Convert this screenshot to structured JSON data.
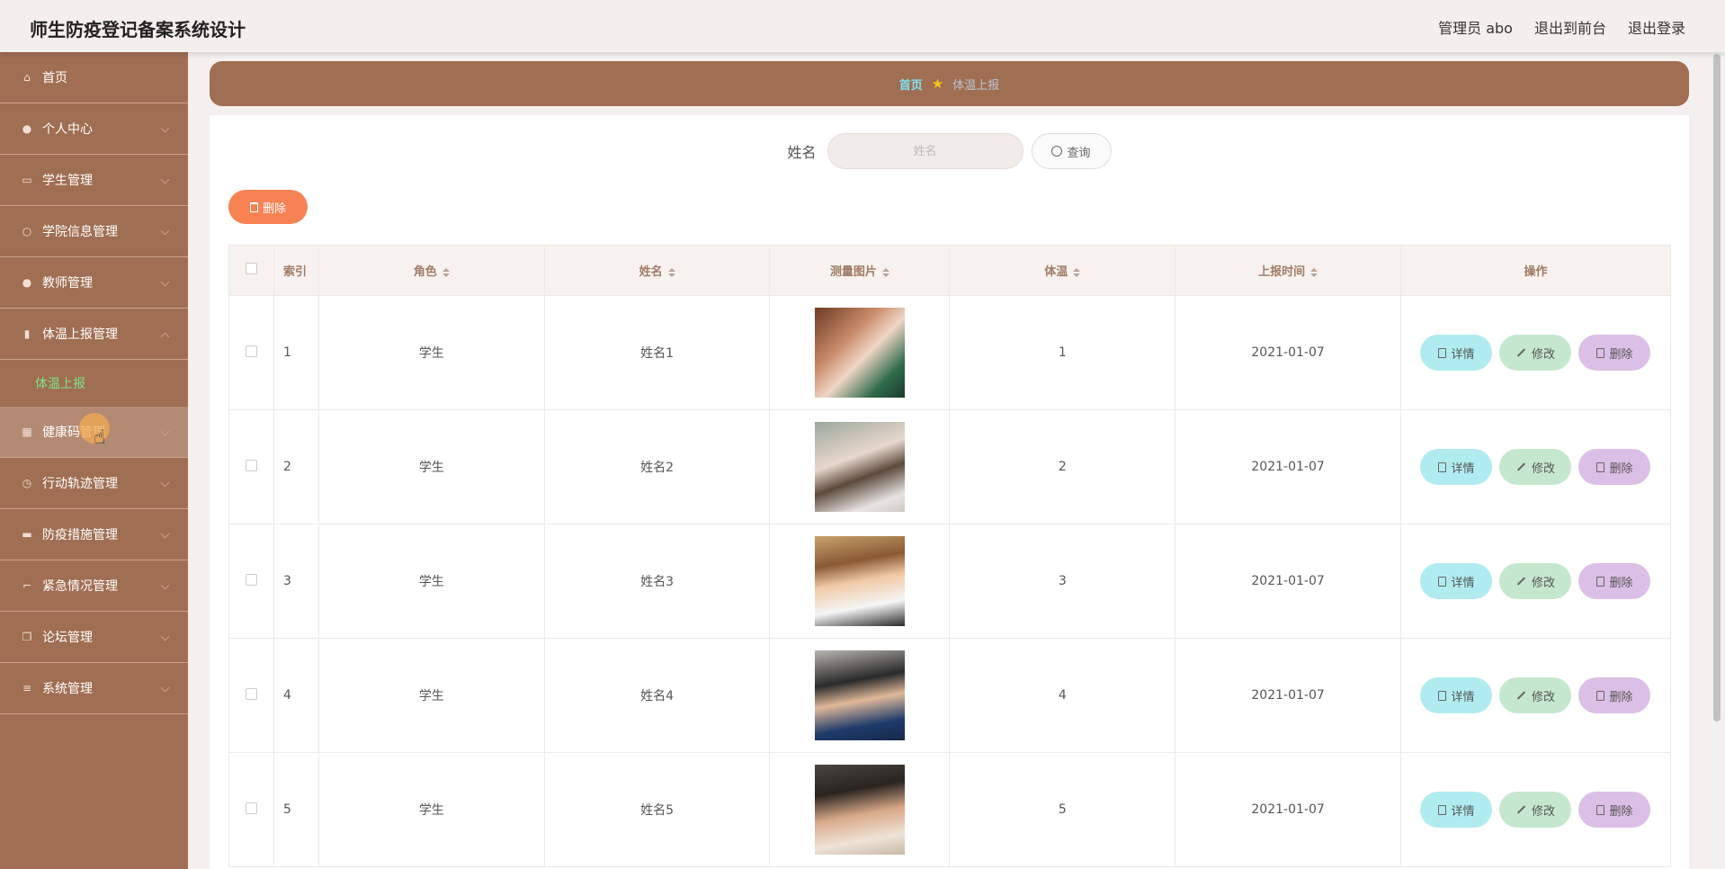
{
  "header": {
    "title": "师生防疫登记备案系统设计",
    "user_label": "管理员 abo",
    "to_front_label": "退出到前台",
    "logout_label": "退出登录"
  },
  "sidebar": {
    "items": [
      {
        "label": "首页",
        "icon": "home-icon"
      },
      {
        "label": "个人中心",
        "icon": "user-icon"
      },
      {
        "label": "学生管理",
        "icon": "card-icon"
      },
      {
        "label": "学院信息管理",
        "icon": "power-icon"
      },
      {
        "label": "教师管理",
        "icon": "user-icon"
      },
      {
        "label": "体温上报管理",
        "icon": "chart-icon",
        "expanded": true
      },
      {
        "label": "健康码管理",
        "icon": "qrcode-icon",
        "hovered": true
      },
      {
        "label": "行动轨迹管理",
        "icon": "clock-icon"
      },
      {
        "label": "防疫措施管理",
        "icon": "chair-icon"
      },
      {
        "label": "紧急情况管理",
        "icon": "crop-icon"
      },
      {
        "label": "论坛管理",
        "icon": "copy-icon"
      },
      {
        "label": "系统管理",
        "icon": "menu-icon"
      }
    ],
    "submenu": {
      "label": "体温上报"
    }
  },
  "breadcrumb": {
    "home": "首页",
    "current": "体温上报"
  },
  "search": {
    "label": "姓名",
    "placeholder": "姓名",
    "button": "查询"
  },
  "toolbar": {
    "delete_label": "删除"
  },
  "table": {
    "headers": {
      "index": "索引",
      "role": "角色",
      "name": "姓名",
      "photo": "测量图片",
      "temp": "体温",
      "time": "上报时间",
      "ops": "操作"
    },
    "actions": {
      "detail": "详情",
      "edit": "修改",
      "delete": "删除"
    },
    "rows": [
      {
        "index": "1",
        "role": "学生",
        "name": "姓名1",
        "temp": "1",
        "time": "2021-01-07"
      },
      {
        "index": "2",
        "role": "学生",
        "name": "姓名2",
        "temp": "2",
        "time": "2021-01-07"
      },
      {
        "index": "3",
        "role": "学生",
        "name": "姓名3",
        "temp": "3",
        "time": "2021-01-07"
      },
      {
        "index": "4",
        "role": "学生",
        "name": "姓名4",
        "temp": "4",
        "time": "2021-01-07"
      },
      {
        "index": "5",
        "role": "学生",
        "name": "姓名5",
        "temp": "5",
        "time": "2021-01-07"
      }
    ]
  },
  "colors": {
    "sidebar": "#a06e52",
    "breadcrumb_bar": "#a06e52",
    "delete_button": "#f78254",
    "detail_button": "#b0ecef",
    "edit_button": "#c6e7cf",
    "row_delete_button": "#dcbfe6",
    "active_submenu": "#7ee28a"
  }
}
